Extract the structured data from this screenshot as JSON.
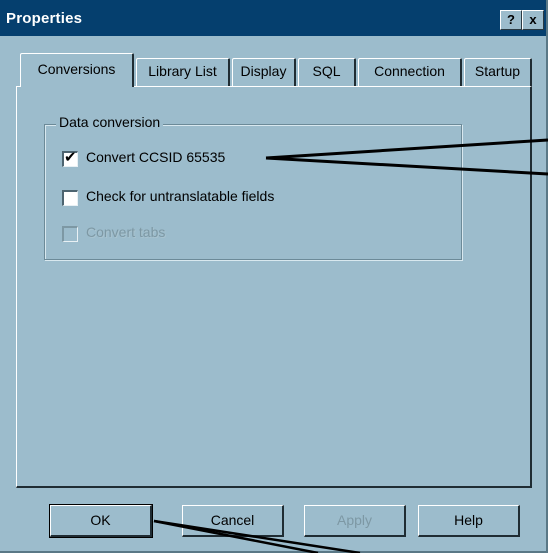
{
  "window": {
    "title": "Properties",
    "help_glyph": "?",
    "close_glyph": "x"
  },
  "tabs": [
    {
      "label": "Conversions",
      "active": true
    },
    {
      "label": "Library List",
      "active": false
    },
    {
      "label": "Display",
      "active": false
    },
    {
      "label": "SQL",
      "active": false
    },
    {
      "label": "Connection",
      "active": false
    },
    {
      "label": "Startup",
      "active": false
    }
  ],
  "group": {
    "label": "Data conversion",
    "options": [
      {
        "label": "Convert CCSID 65535",
        "checked": true,
        "enabled": true
      },
      {
        "label": "Check for untranslatable fields",
        "checked": false,
        "enabled": true
      },
      {
        "label": "Convert tabs",
        "checked": false,
        "enabled": false
      }
    ]
  },
  "buttons": {
    "ok": "OK",
    "cancel": "Cancel",
    "apply": "Apply",
    "help": "Help"
  },
  "colors": {
    "dialog_bg": "#9cbccc",
    "titlebar_bg": "#053f6e",
    "title_text": "#ffffff",
    "disabled_text": "#7d98a4"
  }
}
